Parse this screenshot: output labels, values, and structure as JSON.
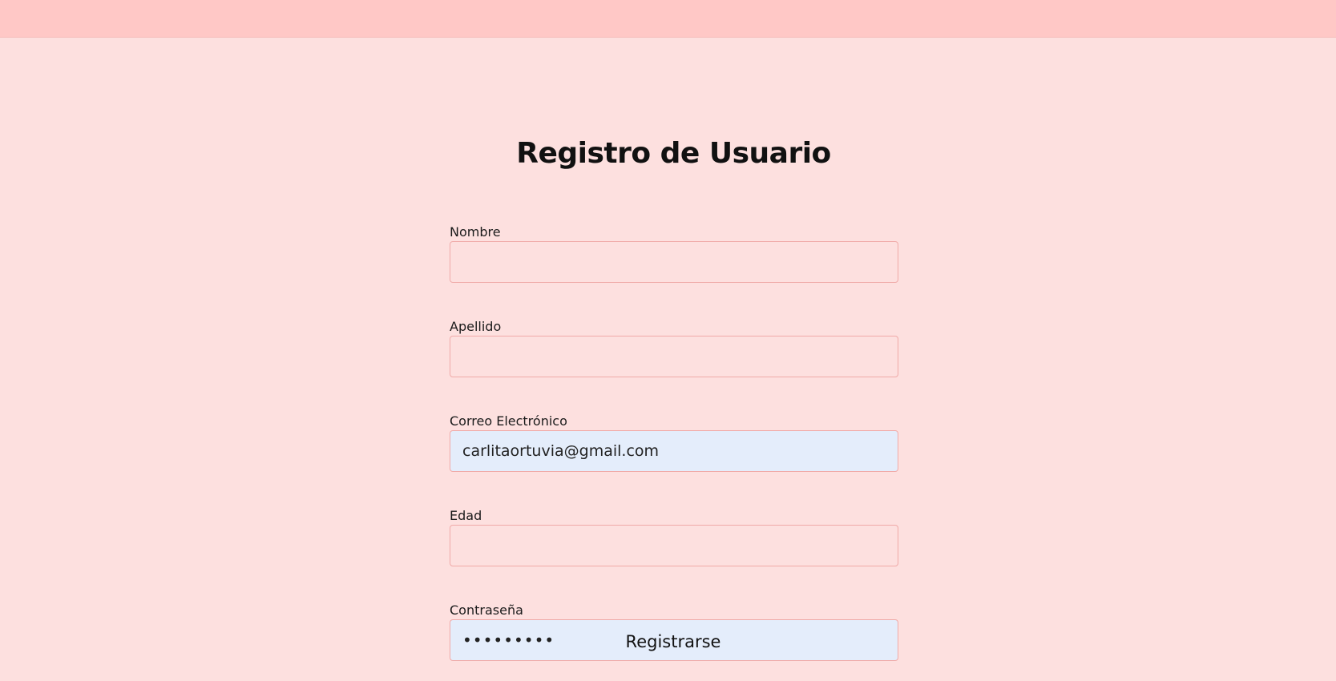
{
  "page": {
    "title": "Registro de Usuario"
  },
  "form": {
    "fields": [
      {
        "label": "Nombre",
        "value": "",
        "type": "text"
      },
      {
        "label": "Apellido",
        "value": "",
        "type": "text"
      },
      {
        "label": "Correo Electrónico",
        "value": "carlitaortuvia@gmail.com",
        "type": "email"
      },
      {
        "label": "Edad",
        "value": "",
        "type": "number"
      },
      {
        "label": "Contraseña",
        "value": "•••••••••",
        "type": "password"
      }
    ],
    "submit_label": "Registrarse"
  },
  "colors": {
    "background": "#fde0df",
    "topbar": "#ffc8c6",
    "input_border": "#f0aaa8",
    "autofill": "#e4edfb"
  }
}
